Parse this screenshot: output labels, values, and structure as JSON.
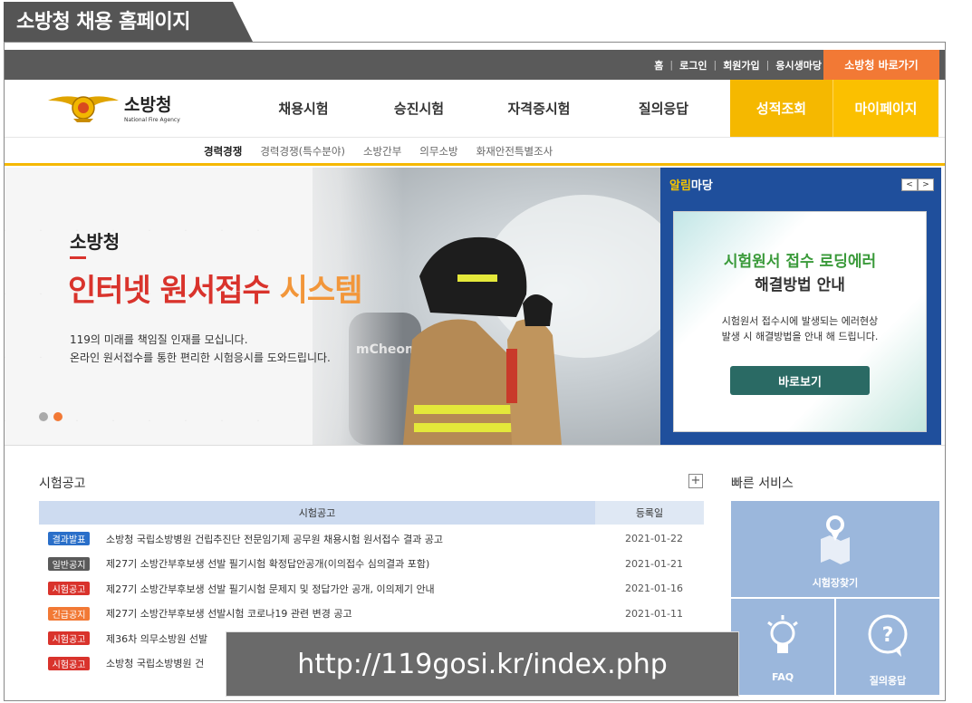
{
  "caption": "소방청 채용 홈페이지",
  "topbar": {
    "links": [
      "홈",
      "로그인",
      "회원가입",
      "응시생마당"
    ],
    "shortcut": "소방청 바로가기"
  },
  "logo": {
    "name": "소방청",
    "sub": "National Fire Agency"
  },
  "gnb": {
    "items": [
      "채용시험",
      "승진시험",
      "자격증시험",
      "질의응답"
    ],
    "highlight1": "성적조회",
    "highlight2": "마이페이지"
  },
  "subnav": [
    "경력경쟁",
    "경력경쟁(특수분야)",
    "소방간부",
    "의무소방",
    "화재안전특별조사"
  ],
  "hero": {
    "line1": "소방청",
    "line2_red": "인터넷 원서접수",
    "line2_orange": "시스템",
    "desc1": "119의 미래를 책임질 인재를 모십니다.",
    "desc2": "온라인 원서접수를 통한 편리한 시험응시를 도와드립니다.",
    "tank_text": "mCheong"
  },
  "notice_panel": {
    "title_y": "알림",
    "title_w": "마당",
    "prev": "<",
    "next": ">",
    "heading1": "시험원서 접수 로딩에러",
    "heading2": "해결방법 안내",
    "desc1": "시험원서 접수시에 발생되는 에러현상",
    "desc2": "발생 시 해결방법을 안내 해 드립니다.",
    "button": "바로보기"
  },
  "exam": {
    "section_title": "시험공고",
    "plus": "+",
    "col_title": "시험공고",
    "col_date": "등록일",
    "rows": [
      {
        "badge": "결과발표",
        "color": "#2a6fc9",
        "title": "소방청 국립소방병원 건립추진단 전문임기제 공무원 채용시험 원서접수 결과 공고",
        "date": "2021-01-22"
      },
      {
        "badge": "일반공지",
        "color": "#5a5a5a",
        "title": "제27기 소방간부후보생 선발 필기시험 확정답안공개(이의접수 심의결과 포함)",
        "date": "2021-01-21"
      },
      {
        "badge": "시험공고",
        "color": "#d9332c",
        "title": "제27기 소방간부후보생 선발 필기시험 문제지 및 정답가안 공개, 이의제기 안내",
        "date": "2021-01-16"
      },
      {
        "badge": "긴급공지",
        "color": "#f27935",
        "title": "제27기 소방간부후보생 선발시험 코로나19 관련 변경 공고",
        "date": "2021-01-11"
      },
      {
        "badge": "시험공고",
        "color": "#d9332c",
        "title": "제36차 의무소방원 선발",
        "date": ""
      },
      {
        "badge": "시험공고",
        "color": "#d9332c",
        "title": "소방청 국립소방병원 건",
        "date": ""
      }
    ]
  },
  "url": "http://119gosi.kr/index.php",
  "quick": {
    "title": "빠른 서비스",
    "item1": "시험장찾기",
    "item2": "FAQ",
    "item3": "질의응답"
  }
}
